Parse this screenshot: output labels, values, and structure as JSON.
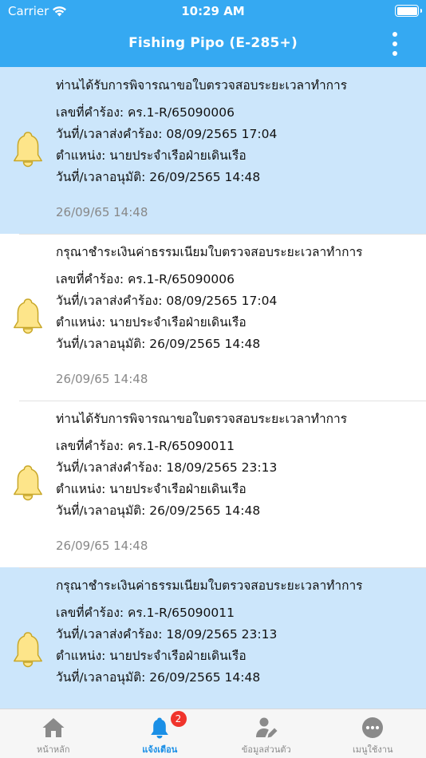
{
  "status_bar": {
    "carrier": "Carrier",
    "time": "10:29 AM"
  },
  "header": {
    "title": "Fishing Pipo (E-285+)"
  },
  "notifications": [
    {
      "title": "ท่านได้รับการพิจารณาขอใบตรวจสอบระยะเวลาทำการ",
      "request_no": "เลขที่คำร้อง: คร.1-R/65090006",
      "submitted": "วันที่/เวลาส่งคำร้อง: 08/09/2565 17:04",
      "position": "ตำแหน่ง: นายประจำเรือฝ่ายเดินเรือ",
      "approved": "วันที่/เวลาอนุมัติ: 26/09/2565 14:48",
      "timestamp": "26/09/65 14:48",
      "highlighted": true
    },
    {
      "title": "กรุณาชำระเงินค่าธรรมเนียมใบตรวจสอบระยะเวลาทำการ",
      "request_no": "เลขที่คำร้อง: คร.1-R/65090006",
      "submitted": "วันที่/เวลาส่งคำร้อง: 08/09/2565 17:04",
      "position": "ตำแหน่ง: นายประจำเรือฝ่ายเดินเรือ",
      "approved": "วันที่/เวลาอนุมัติ: 26/09/2565 14:48",
      "timestamp": "26/09/65 14:48",
      "highlighted": false
    },
    {
      "title": "ท่านได้รับการพิจารณาขอใบตรวจสอบระยะเวลาทำการ",
      "request_no": "เลขที่คำร้อง: คร.1-R/65090011",
      "submitted": "วันที่/เวลาส่งคำร้อง: 18/09/2565 23:13",
      "position": "ตำแหน่ง: นายประจำเรือฝ่ายเดินเรือ",
      "approved": "วันที่/เวลาอนุมัติ: 26/09/2565 14:48",
      "timestamp": "26/09/65 14:48",
      "highlighted": false
    },
    {
      "title": "กรุณาชำระเงินค่าธรรมเนียมใบตรวจสอบระยะเวลาทำการ",
      "request_no": "เลขที่คำร้อง: คร.1-R/65090011",
      "submitted": "วันที่/เวลาส่งคำร้อง: 18/09/2565 23:13",
      "position": "ตำแหน่ง: นายประจำเรือฝ่ายเดินเรือ",
      "approved": "วันที่/เวลาอนุมัติ: 26/09/2565 14:48",
      "timestamp": "",
      "highlighted": true
    }
  ],
  "tabbar": {
    "home": {
      "label": "หน้าหลัก",
      "icon": "home-icon"
    },
    "notifications": {
      "label": "แจ้งเตือน",
      "icon": "bell-icon",
      "badge": "2"
    },
    "profile": {
      "label": "ข้อมูลส่วนตัว",
      "icon": "profile-edit-icon"
    },
    "menu": {
      "label": "เมนูใช้งาน",
      "icon": "more-icon"
    }
  },
  "colors": {
    "header_bg": "#35a9f2",
    "highlight_row": "#cce6fb",
    "bell_fill": "#fde58a",
    "active_tab": "#1a8fe6",
    "badge": "#f0342c"
  }
}
